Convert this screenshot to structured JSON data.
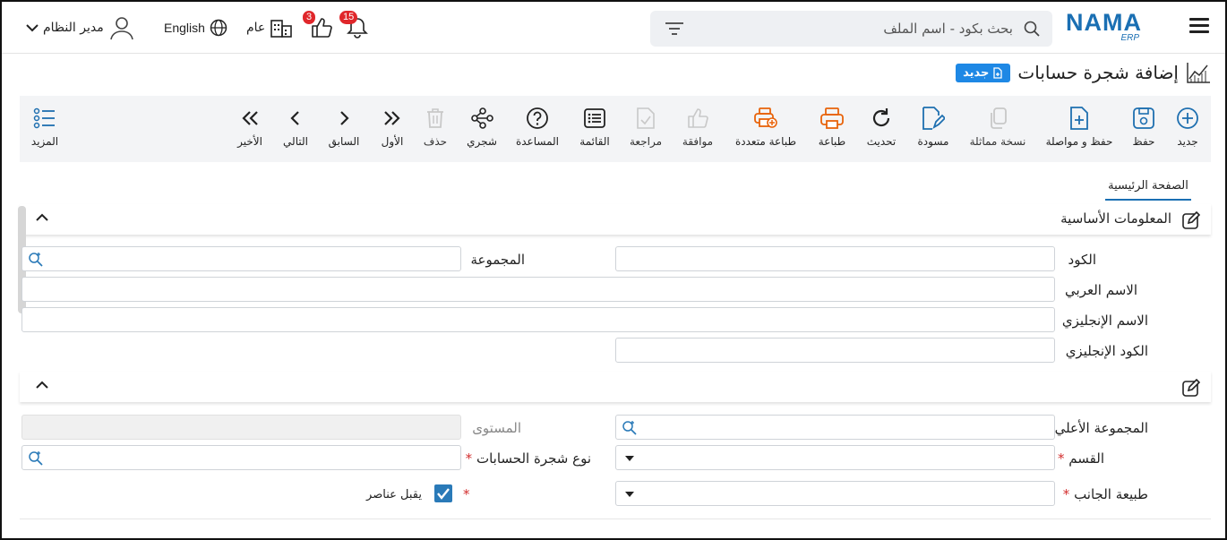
{
  "header": {
    "logo_main": "NAMA",
    "logo_sub": "ERP",
    "search_placeholder": "بحث بكود - اسم الملف",
    "notifications_count": "15",
    "likes_count": "3",
    "company_label": "عام",
    "language_label": "English",
    "user_label": "مدير النظام"
  },
  "page": {
    "title": "إضافة شجرة حسابات",
    "badge": "جديد"
  },
  "toolbar": {
    "new": "جديد",
    "save": "حفظ",
    "save_continue": "حفظ و مواصلة",
    "duplicate": "نسخة مماثلة",
    "draft": "مسودة",
    "refresh": "تحديث",
    "print": "طباعة",
    "multi_print": "طباعة متعددة",
    "approve": "موافقة",
    "review": "مراجعة",
    "list": "القائمة",
    "help": "المساعدة",
    "tree": "شجري",
    "delete": "حذف",
    "first": "الأول",
    "previous": "السابق",
    "next": "التالي",
    "last": "الأخير",
    "more": "المزيد"
  },
  "tabs": {
    "main": "الصفحة الرئيسية"
  },
  "sections": {
    "basic_info": "المعلومات الأساسية"
  },
  "form": {
    "code": "الكود",
    "group": "المجموعة",
    "arabic_name": "الاسم العربي",
    "english_name": "الاسم الإنجليزي",
    "english_code": "الكود الإنجليزي",
    "parent_group": "المجموعة الأعلي",
    "level": "المستوى",
    "section": "القسم",
    "account_tree_type": "نوع شجرة الحسابات",
    "side_nature": "طبيعة الجانب",
    "accepts_items": "يقبل عناصر",
    "required_mark": "*"
  },
  "colors": {
    "brand": "#1a6fb3",
    "toolbar_blue": "#1e6fb0",
    "print_orange": "#e8630a",
    "badge_red": "#e0272b",
    "checkbox": "#2a7ab8"
  }
}
